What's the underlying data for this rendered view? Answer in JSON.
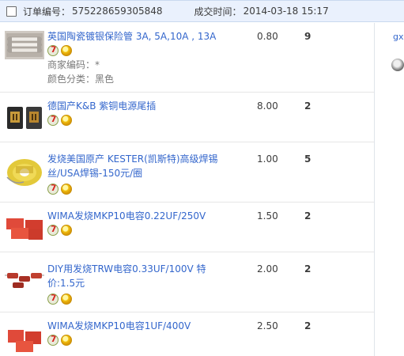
{
  "order": {
    "number_label": "订单编号：",
    "number": "575228659305848",
    "time_label": "成交时间：",
    "time": "2014-03-18 15:17"
  },
  "side": {
    "text": "gx"
  },
  "badges": {
    "seven": "7"
  },
  "items": [
    {
      "title": "英国陶瓷镀银保险管 3A, 5A,10A , 13A",
      "merchant_code": "商家编码：*",
      "color_category": "颜色分类：黑色",
      "price": "0.80",
      "quantity": "9",
      "thumb_icon": "fuse-icon"
    },
    {
      "title": "德国产K&B 紫铜电源尾插",
      "price": "8.00",
      "quantity": "2",
      "thumb_icon": "power-plug-icon"
    },
    {
      "title": "发烧美国原产 KESTER(凯斯特)高级焊锡丝/USA焊锡-150元/圈",
      "price": "1.00",
      "quantity": "5",
      "thumb_icon": "solder-spool-icon"
    },
    {
      "title": "WIMA发烧MKP10电容0.22UF/250V",
      "price": "1.50",
      "quantity": "2",
      "thumb_icon": "capacitor-icon"
    },
    {
      "title": "DIY用发烧TRW电容0.33UF/100V 特价:1.5元",
      "price": "2.00",
      "quantity": "2",
      "thumb_icon": "capacitor-icon"
    },
    {
      "title": "WIMA发烧MKP10电容1UF/400V",
      "price": "2.50",
      "quantity": "2",
      "thumb_icon": "capacitor-icon"
    }
  ]
}
